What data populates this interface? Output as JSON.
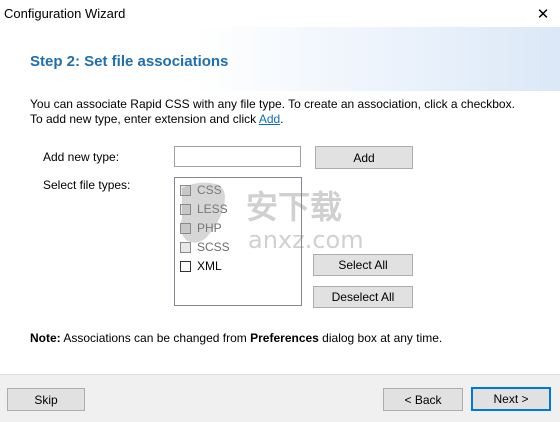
{
  "window": {
    "title": "Configuration Wizard",
    "close_glyph": "✕"
  },
  "header": {
    "heading": "Step 2: Set file associations"
  },
  "intro": {
    "text": "You can associate Rapid CSS with any file type. To create an association, click a checkbox. To add new type, enter extension and click ",
    "link": "Add",
    "end": "."
  },
  "form": {
    "add_type_label": "Add new type:",
    "add_type_value": "",
    "add_button": "Add",
    "select_types_label": "Select file types:",
    "file_types": [
      {
        "label": "CSS",
        "checked": false
      },
      {
        "label": "LESS",
        "checked": false
      },
      {
        "label": "PHP",
        "checked": false
      },
      {
        "label": "SCSS",
        "checked": false
      },
      {
        "label": "XML",
        "checked": false
      }
    ],
    "select_all": "Select All",
    "deselect_all": "Deselect All"
  },
  "note": {
    "bold": "Note:",
    "text1": " Associations can be changed from ",
    "bold2": "Preferences",
    "text2": " dialog box at any time."
  },
  "footer": {
    "skip": "Skip",
    "back": "< Back",
    "next": "Next >"
  },
  "watermark": {
    "line1": "安下载",
    "line2": "anxz.com"
  }
}
